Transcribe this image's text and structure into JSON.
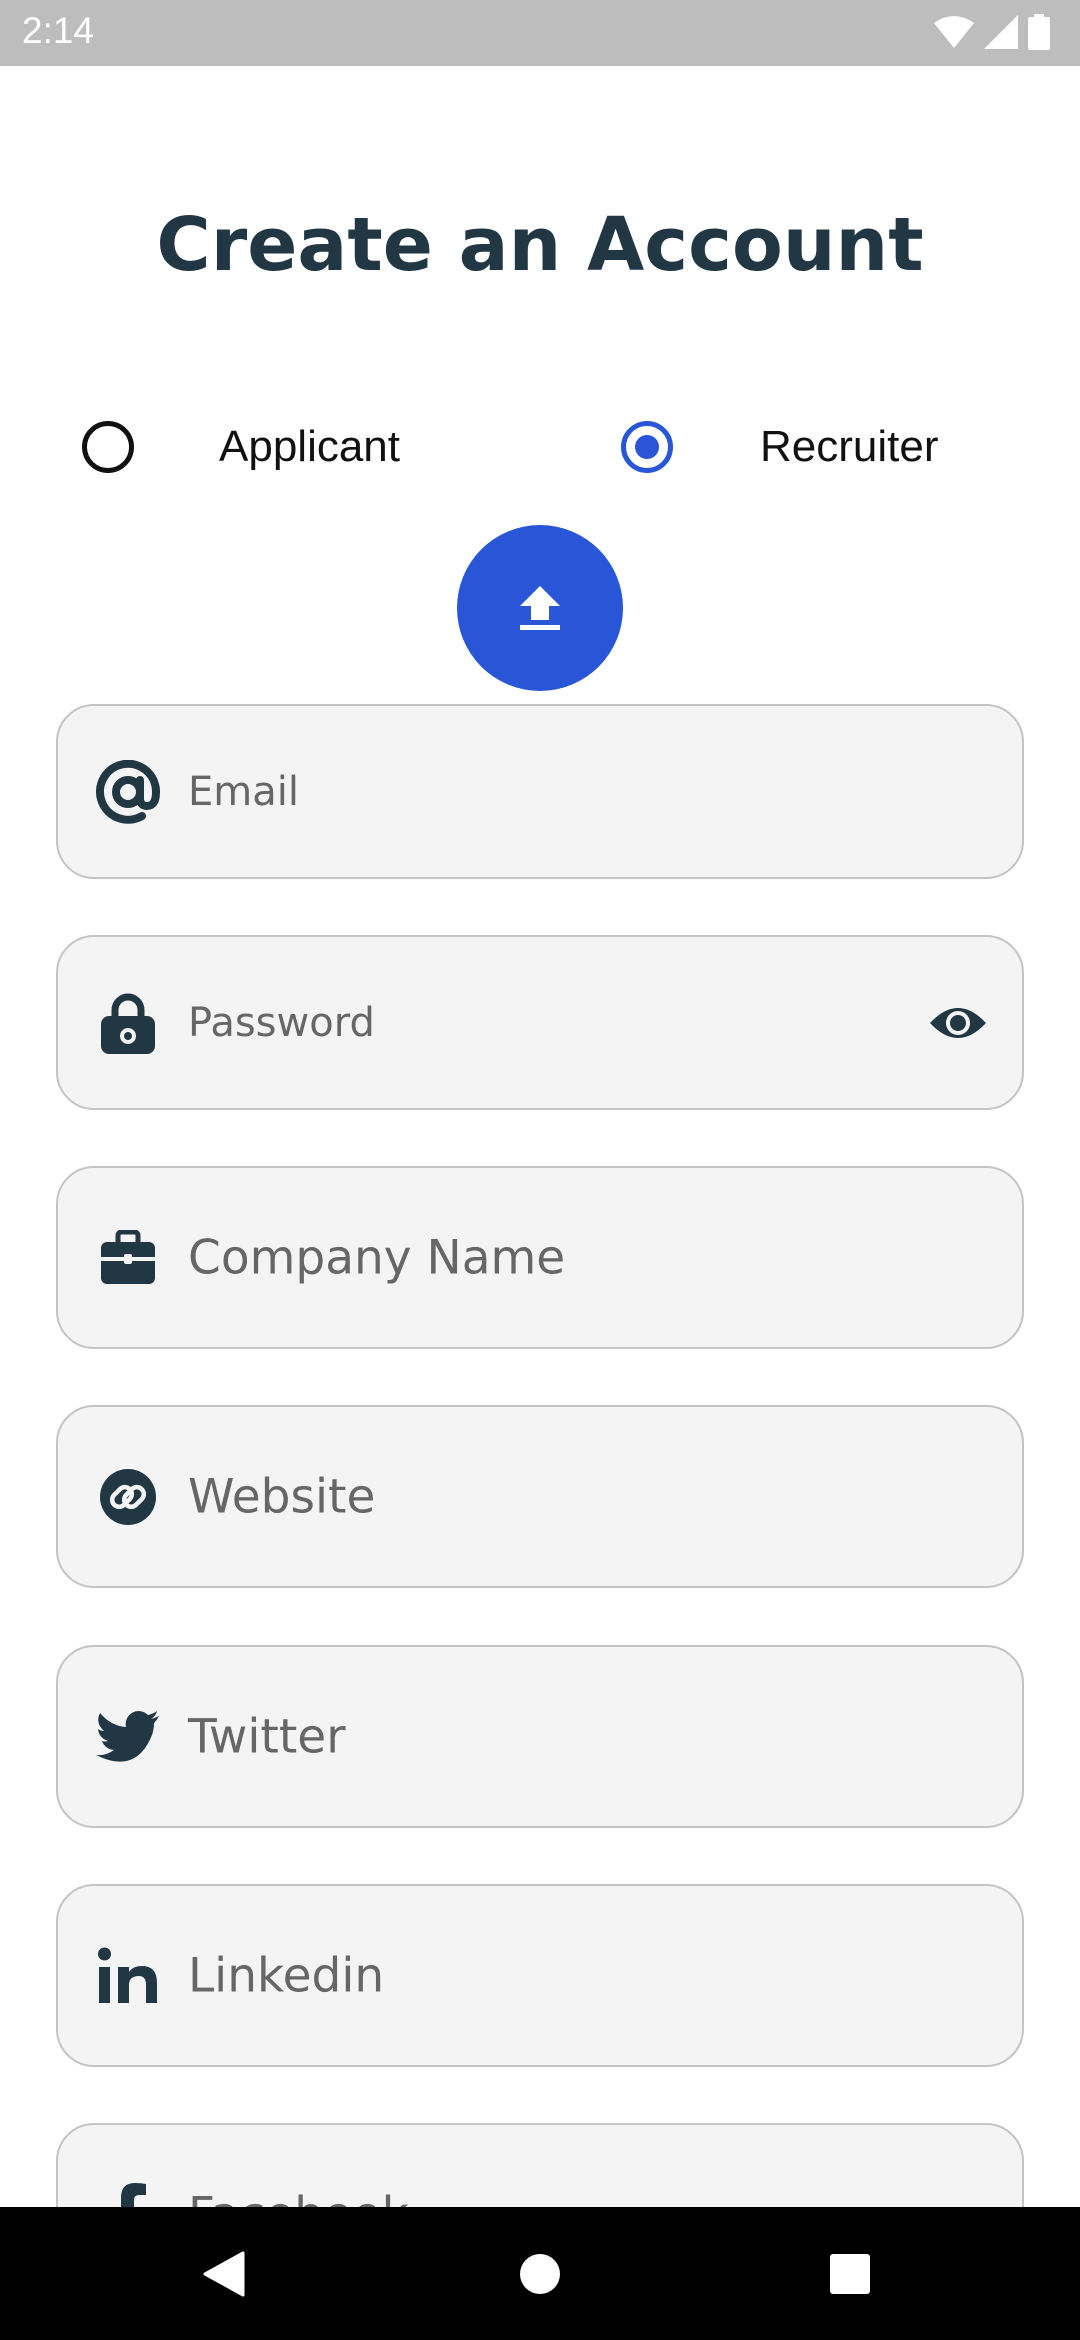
{
  "status_bar": {
    "time": "2:14"
  },
  "title": "Create an Account",
  "roles": [
    {
      "label": "Applicant",
      "selected": false
    },
    {
      "label": "Recruiter",
      "selected": true
    }
  ],
  "upload": {
    "icon": "upload-icon"
  },
  "fields": {
    "email": {
      "label": "Email",
      "icon": "at-sign-icon"
    },
    "password": {
      "label": "Password",
      "icon": "lock-icon",
      "toggle_icon": "eye-icon"
    },
    "company": {
      "label": "Company Name",
      "icon": "briefcase-icon"
    },
    "website": {
      "label": "Website",
      "icon": "link-icon"
    },
    "twitter": {
      "label": "Twitter",
      "icon": "twitter-icon"
    },
    "linkedin": {
      "label": "Linkedin",
      "icon": "linkedin-icon"
    },
    "facebook": {
      "label": "Facebook",
      "icon": "facebook-icon"
    }
  },
  "colors": {
    "accent": "#2856d6",
    "title": "#223744",
    "field_bg": "#f4f4f4",
    "field_border": "#c4c4c4",
    "icon": "#223744"
  }
}
